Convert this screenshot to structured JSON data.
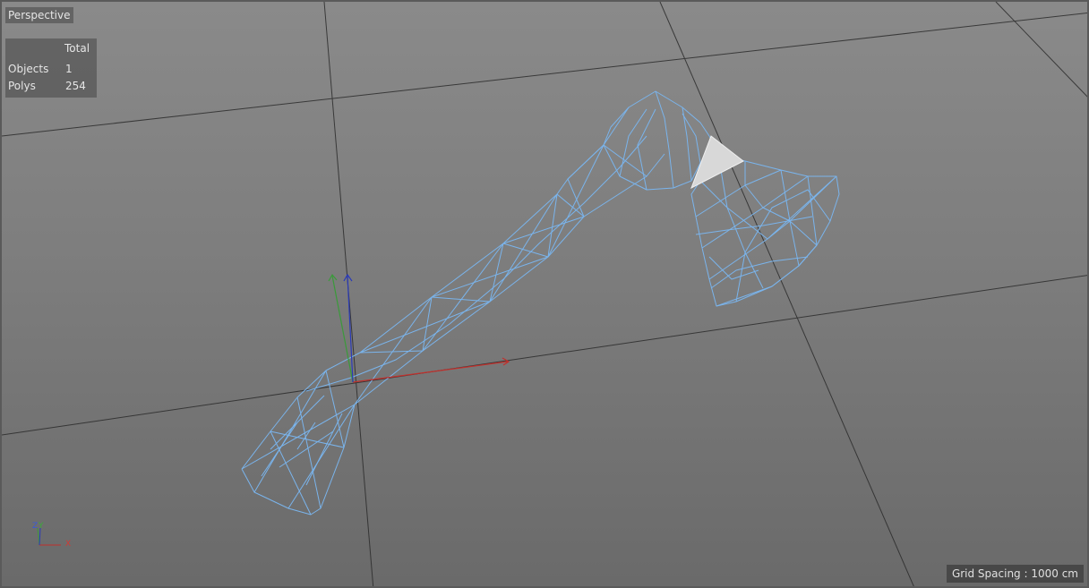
{
  "viewport": {
    "title": "Perspective",
    "grid_spacing": "Grid Spacing : 1000 cm"
  },
  "hud": {
    "header": "Total",
    "rows": [
      {
        "label": "Objects",
        "value": "1"
      },
      {
        "label": "Polys",
        "value": "254"
      }
    ]
  },
  "axis_gizmo": {
    "x_label": "X",
    "y_label": "Y",
    "z_label": "Z"
  },
  "colors": {
    "wireframe": "#7ab4ec",
    "selected_poly": "#d8d8d8",
    "axis_x": "#c0302c",
    "axis_y": "#3a9a3a",
    "axis_z": "#2a3ab8",
    "grid_line": "#2c2c2c"
  },
  "scene": {
    "object": "axe",
    "display_mode": "wireframe",
    "selection": "1 polygon"
  }
}
